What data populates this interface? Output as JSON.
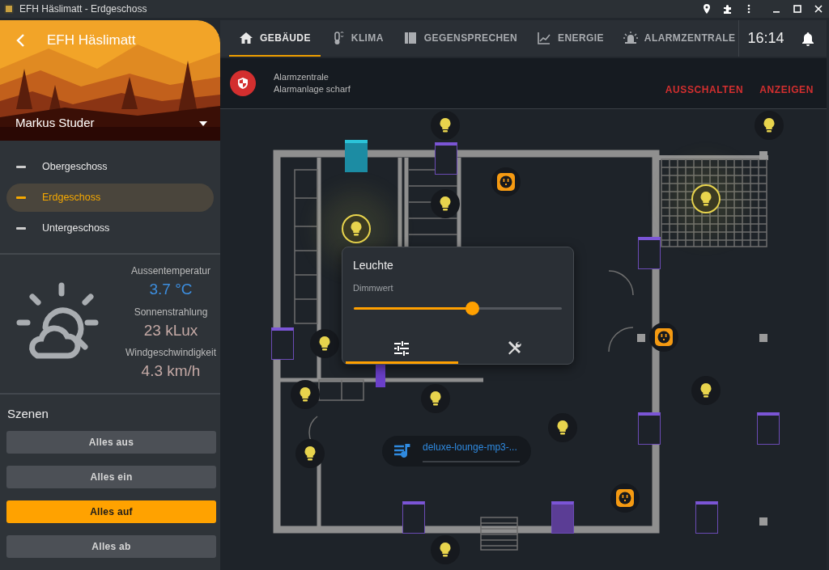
{
  "window": {
    "title": "EFH Häslimatt - Erdgeschoss"
  },
  "sidebar": {
    "title": "EFH Häslimatt",
    "user": "Markus Studer",
    "floors": [
      {
        "label": "Obergeschoss",
        "selected": false
      },
      {
        "label": "Erdgeschoss",
        "selected": true
      },
      {
        "label": "Untergeschoss",
        "selected": false
      }
    ],
    "weather": [
      {
        "label": "Aussentemperatur",
        "value": "3.7 °C",
        "color": "#3d8fe0"
      },
      {
        "label": "Sonnenstrahlung",
        "value": "23 kLux",
        "color": "#c4a9a5"
      },
      {
        "label": "Windgeschwindigkeit",
        "value": "4.3 km/h",
        "color": "#c4a9a5"
      }
    ],
    "scenes": {
      "title": "Szenen",
      "buttons": [
        {
          "label": "Alles aus",
          "selected": false
        },
        {
          "label": "Alles ein",
          "selected": false
        },
        {
          "label": "Alles auf",
          "selected": true
        },
        {
          "label": "Alles ab",
          "selected": false
        }
      ]
    }
  },
  "tabs": [
    {
      "label": "GEBÄUDE",
      "selected": true
    },
    {
      "label": "KLIMA",
      "selected": false
    },
    {
      "label": "GEGENSPRECHEN",
      "selected": false
    },
    {
      "label": "ENERGIE",
      "selected": false
    },
    {
      "label": "ALARMZENTRALE",
      "selected": false
    }
  ],
  "clock": "16:14",
  "alarm": {
    "title": "Alarmzentrale",
    "status": "Alarmanlage scharf",
    "actions": [
      "AUSSCHALTEN",
      "ANZEIGEN"
    ]
  },
  "devices": [
    {
      "kind": "light",
      "on": false
    },
    {
      "kind": "light",
      "on": false
    },
    {
      "kind": "window"
    },
    {
      "kind": "shutter",
      "closed": false
    },
    {
      "kind": "outlet"
    },
    {
      "kind": "light",
      "on": false
    },
    {
      "kind": "light",
      "on": true
    },
    {
      "kind": "light",
      "on": true
    },
    {
      "kind": "shutter",
      "closed": false
    },
    {
      "kind": "light",
      "on": false
    },
    {
      "kind": "shutter",
      "closed": false
    },
    {
      "kind": "outlet"
    },
    {
      "kind": "door"
    },
    {
      "kind": "light",
      "on": false
    },
    {
      "kind": "light",
      "on": false
    },
    {
      "kind": "light",
      "on": false
    },
    {
      "kind": "light",
      "on": false
    },
    {
      "kind": "shutter",
      "closed": false
    },
    {
      "kind": "shutter",
      "closed": false
    },
    {
      "kind": "light",
      "on": false
    },
    {
      "kind": "outlet"
    },
    {
      "kind": "shutter",
      "closed": false
    },
    {
      "kind": "shutter",
      "closed": true
    },
    {
      "kind": "shutter",
      "closed": false
    },
    {
      "kind": "light",
      "on": false
    }
  ],
  "media": {
    "title": "deluxe-lounge-mp3-..."
  },
  "popup": {
    "title": "Leuchte",
    "slider": {
      "label": "Dimmwert",
      "level": 0.57
    },
    "tabs": [
      {
        "selected": true
      },
      {
        "selected": false
      }
    ]
  }
}
